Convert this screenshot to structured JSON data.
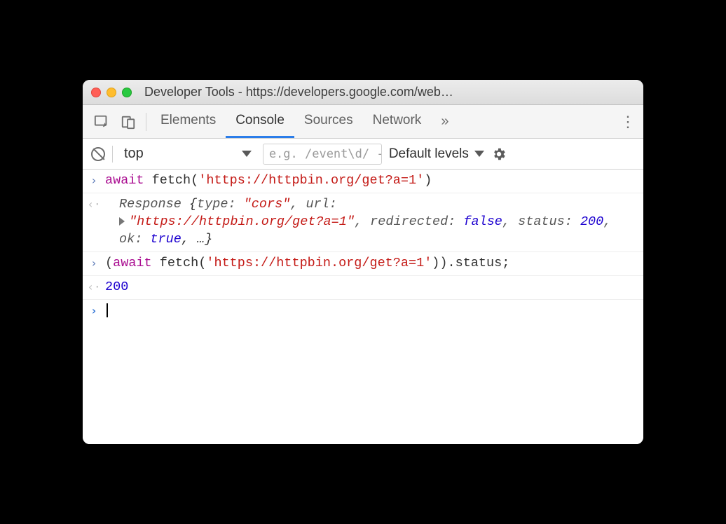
{
  "window": {
    "title": "Developer Tools - https://developers.google.com/web…"
  },
  "tabs": {
    "elements": "Elements",
    "console": "Console",
    "sources": "Sources",
    "network": "Network",
    "more": "»"
  },
  "toolbar": {
    "context": "top",
    "filter_placeholder": "e.g. /event\\d/ -c",
    "levels": "Default levels"
  },
  "console": {
    "line1": {
      "kw": "await",
      "fn": " fetch(",
      "str": "'https://httpbin.org/get?a=1'",
      "close": ")"
    },
    "line2": {
      "prefix": "Response ",
      "open": "{",
      "p_type": "type: ",
      "v_type": "\"cors\"",
      "p_url": ", url:",
      "v_url": "\"https://httpbin.org/get?a=1\"",
      "p_redir": ", redirected: ",
      "v_redir": "false",
      "p_status": ", status: ",
      "v_status": "200",
      "p_ok": ", ok: ",
      "v_ok": "true",
      "tail": ", …}"
    },
    "line3": {
      "open": "(",
      "kw": "await",
      "fn": " fetch(",
      "str": "'https://httpbin.org/get?a=1'",
      "close": ")).status;"
    },
    "line4": {
      "value": "200"
    },
    "prompt": ""
  }
}
